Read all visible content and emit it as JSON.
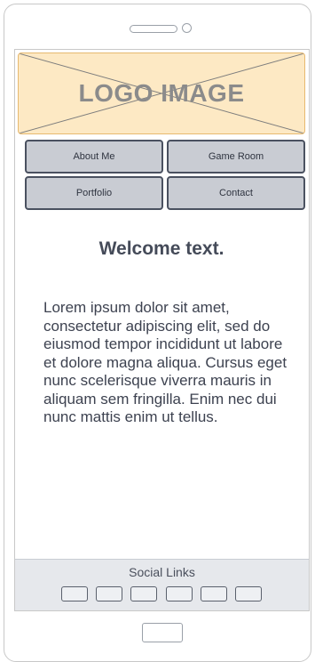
{
  "logo": {
    "text": "LOGO IMAGE"
  },
  "nav": {
    "about": "About Me",
    "game_room": "Game Room",
    "portfolio": "Portfolio",
    "contact": "Contact"
  },
  "main": {
    "welcome": "Welcome text.",
    "body": "Lorem ipsum dolor sit amet, consectetur adipiscing elit, sed do eiusmod tempor incididunt ut labore et dolore magna aliqua. Cursus eget nunc scelerisque viverra mauris in aliquam sem fringilla. Enim nec dui nunc mattis enim ut tellus."
  },
  "footer": {
    "label": "Social Links",
    "links": [
      "social-link",
      "social-link",
      "social-link",
      "social-link",
      "social-link",
      "social-link"
    ]
  },
  "colors": {
    "logo_fill": "#fde9c4",
    "button_fill": "#c9ccd3",
    "text": "#3d4250"
  }
}
